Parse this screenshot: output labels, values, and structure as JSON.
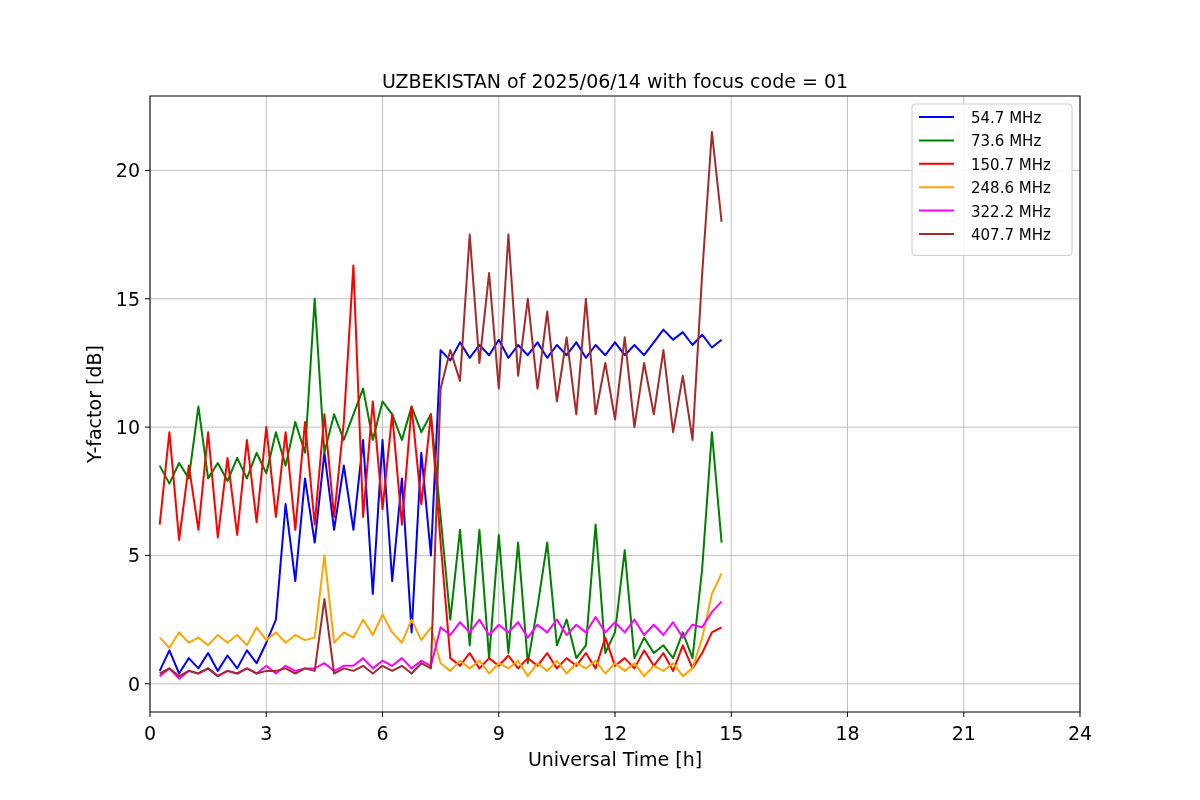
{
  "chart_data": {
    "type": "line",
    "title": "UZBEKISTAN of 2025/06/14 with focus code = 01",
    "xlabel": "Universal Time [h]",
    "ylabel": "Y-factor [dB]",
    "x": [
      0.25,
      0.5,
      0.75,
      1,
      1.25,
      1.5,
      1.75,
      2,
      2.25,
      2.5,
      2.75,
      3,
      3.25,
      3.5,
      3.75,
      4,
      4.25,
      4.5,
      4.75,
      5,
      5.25,
      5.5,
      5.75,
      6,
      6.25,
      6.5,
      6.75,
      7,
      7.25,
      7.5,
      7.75,
      8,
      8.25,
      8.5,
      8.75,
      9,
      9.25,
      9.5,
      9.75,
      10,
      10.25,
      10.5,
      10.75,
      11,
      11.25,
      11.5,
      11.75,
      12,
      12.25,
      12.5,
      12.75,
      13,
      13.25,
      13.5,
      13.75,
      14,
      14.25,
      14.5,
      14.75
    ],
    "grid": true,
    "legend": true,
    "xlim": [
      0,
      24
    ],
    "ylim": [
      -1.1,
      22.9
    ],
    "xticks": [
      0,
      3,
      6,
      9,
      12,
      15,
      18,
      21,
      24
    ],
    "yticks": [
      0,
      5,
      10,
      15,
      20
    ],
    "series": [
      {
        "name": "54.7 MHz",
        "color": "#0000ff",
        "values": [
          0.5,
          1.3,
          0.4,
          1.0,
          0.6,
          1.2,
          0.5,
          1.1,
          0.6,
          1.3,
          0.8,
          1.6,
          2.5,
          7,
          4,
          8,
          5.5,
          9,
          6,
          8.5,
          6,
          9.5,
          3.5,
          9.5,
          4,
          8,
          2,
          9,
          5,
          13,
          12.6,
          13.3,
          12.7,
          13.2,
          12.8,
          13.4,
          12.7,
          13.2,
          12.8,
          13.3,
          12.7,
          13.2,
          12.8,
          13.3,
          12.7,
          13.2,
          12.8,
          13.3,
          12.8,
          13.2,
          12.8,
          13.3,
          13.8,
          13.4,
          13.7,
          13.2,
          13.6,
          13.1,
          13.4
        ]
      },
      {
        "name": "73.6 MHz",
        "color": "#008000",
        "values": [
          8.5,
          7.8,
          8.6,
          8.0,
          10.8,
          8.0,
          8.6,
          7.9,
          8.8,
          8.0,
          9.0,
          8.2,
          9.8,
          8.5,
          10.2,
          9.0,
          15,
          9.0,
          10.5,
          9.5,
          10.5,
          11.5,
          9.5,
          11.0,
          10.5,
          9.5,
          10.8,
          9.8,
          10.5,
          6.5,
          2.5,
          6.0,
          1.5,
          6.0,
          1.0,
          5.8,
          1.2,
          5.5,
          0.8,
          3.0,
          5.5,
          1.5,
          2.5,
          1.0,
          1.5,
          6.2,
          1.2,
          2.0,
          5.2,
          1.0,
          1.8,
          1.2,
          1.5,
          1.0,
          2.0,
          1.0,
          4.5,
          9.8,
          5.5
        ]
      },
      {
        "name": "150.7 MHz",
        "color": "#ff0000",
        "values": [
          6.2,
          9.8,
          5.6,
          8.5,
          6.0,
          9.8,
          5.7,
          8.8,
          5.8,
          9.5,
          6.3,
          10.0,
          6.5,
          9.8,
          6.0,
          10.2,
          6.2,
          10.5,
          6.5,
          10.2,
          16.3,
          6.5,
          11.0,
          6.8,
          10.5,
          6.2,
          10.8,
          7.0,
          10.5,
          5.5,
          1.0,
          0.7,
          1.2,
          0.6,
          1.0,
          0.7,
          1.1,
          0.6,
          1.0,
          0.7,
          1.2,
          0.6,
          1.0,
          0.7,
          1.2,
          0.6,
          1.8,
          0.7,
          1.0,
          0.6,
          1.3,
          0.7,
          1.2,
          0.5,
          1.5,
          0.6,
          1.2,
          2.0,
          2.2
        ]
      },
      {
        "name": "248.6 MHz",
        "color": "#ffa500",
        "values": [
          1.8,
          1.4,
          2.0,
          1.6,
          1.8,
          1.5,
          1.9,
          1.6,
          1.9,
          1.5,
          2.2,
          1.7,
          2.0,
          1.6,
          1.9,
          1.7,
          1.8,
          5.0,
          1.6,
          2.0,
          1.8,
          2.5,
          1.9,
          2.7,
          2.0,
          1.6,
          2.5,
          1.7,
          2.2,
          0.8,
          0.5,
          0.9,
          0.6,
          0.9,
          0.4,
          0.8,
          0.6,
          0.9,
          0.3,
          0.8,
          0.5,
          0.9,
          0.4,
          0.8,
          0.6,
          0.9,
          0.4,
          0.8,
          0.5,
          0.8,
          0.3,
          0.7,
          0.5,
          0.8,
          0.3,
          0.6,
          1.8,
          3.5,
          4.3
        ]
      },
      {
        "name": "322.2 MHz",
        "color": "#ff00ff",
        "values": [
          0.3,
          0.6,
          0.2,
          0.5,
          0.4,
          0.6,
          0.3,
          0.5,
          0.4,
          0.6,
          0.4,
          0.7,
          0.4,
          0.7,
          0.5,
          0.6,
          0.6,
          0.8,
          0.5,
          0.7,
          0.7,
          1.0,
          0.6,
          0.9,
          0.7,
          1.0,
          0.6,
          0.9,
          0.7,
          2.2,
          1.9,
          2.4,
          2.0,
          2.5,
          1.9,
          2.3,
          2.0,
          2.4,
          1.8,
          2.3,
          2.0,
          2.5,
          1.9,
          2.3,
          2.0,
          2.6,
          2.0,
          2.4,
          2.0,
          2.5,
          1.9,
          2.3,
          1.9,
          2.4,
          1.8,
          2.3,
          2.2,
          2.8,
          3.2
        ]
      },
      {
        "name": "407.7 MHz",
        "color": "#a52a2a",
        "values": [
          0.4,
          0.6,
          0.3,
          0.5,
          0.4,
          0.6,
          0.3,
          0.5,
          0.4,
          0.6,
          0.4,
          0.5,
          0.5,
          0.6,
          0.4,
          0.6,
          0.5,
          3.3,
          0.4,
          0.6,
          0.5,
          0.7,
          0.4,
          0.7,
          0.5,
          0.7,
          0.4,
          0.8,
          0.6,
          11.5,
          13,
          11.8,
          17.5,
          12.5,
          16,
          11.5,
          17.5,
          12,
          15,
          11.5,
          14.5,
          11,
          13.5,
          10.5,
          15,
          10.5,
          12.5,
          10.3,
          13.5,
          10,
          12.5,
          10.5,
          13,
          9.8,
          12,
          9.5,
          16,
          21.5,
          18
        ]
      }
    ]
  }
}
